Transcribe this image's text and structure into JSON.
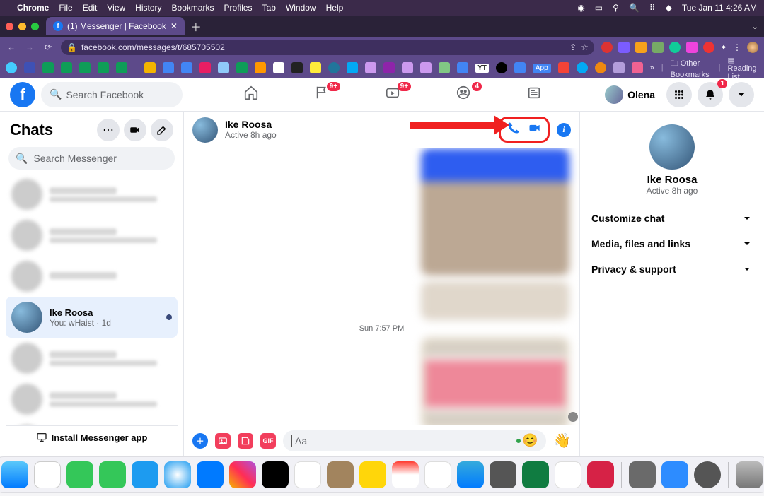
{
  "mac_menu": {
    "app": "Chrome",
    "items": [
      "File",
      "Edit",
      "View",
      "History",
      "Bookmarks",
      "Profiles",
      "Tab",
      "Window",
      "Help"
    ],
    "clock": "Tue Jan 11  4:26 AM"
  },
  "chrome": {
    "tab_title": "(1) Messenger | Facebook",
    "url": "facebook.com/messages/t/685705502",
    "other_bookmarks": "Other Bookmarks",
    "reading_list": "Reading List",
    "bookmark_bar_label_yt": "YT",
    "bookmark_bar_label_app": "App"
  },
  "fb": {
    "search_placeholder": "Search Facebook",
    "nav_badges": {
      "flag": "9+",
      "watch": "9+",
      "group": "4",
      "bell": "1"
    },
    "profile_name": "Olena"
  },
  "left": {
    "title": "Chats",
    "search_placeholder": "Search Messenger",
    "selected": {
      "name": "Ike Roosa",
      "preview": "You: wHaist · 1d"
    },
    "install": "Install Messenger app"
  },
  "conversation": {
    "name": "Ike Roosa",
    "presence": "Active 8h ago",
    "timestamp": "Sun 7:57 PM",
    "composer_placeholder": "Aa",
    "thumbs": "👋"
  },
  "right": {
    "name": "Ike Roosa",
    "presence": "Active 8h ago",
    "sections": [
      "Customize chat",
      "Media, files and links",
      "Privacy & support"
    ]
  }
}
